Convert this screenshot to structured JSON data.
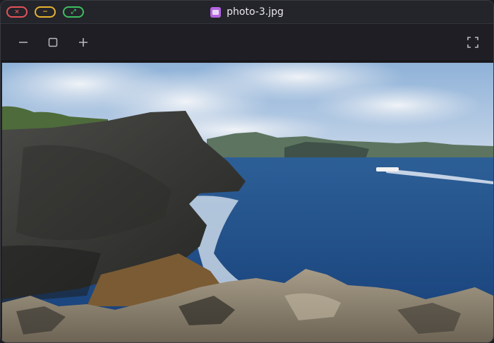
{
  "window": {
    "title": "photo-3.jpg",
    "controls": {
      "close_glyph": "×",
      "minimize_glyph": "−",
      "zoom_glyph": "⤢"
    }
  },
  "toolbar": {
    "zoom_out_icon": "minus-icon",
    "actual_size_icon": "square-icon",
    "zoom_in_icon": "plus-icon",
    "fullscreen_icon": "fullscreen-icon"
  },
  "image": {
    "subject": "rocky sea cliffs and blue ocean",
    "colors": {
      "sky": "#a9c3e0",
      "sea": "#1e4f8f",
      "rock": "#3a3a38"
    }
  }
}
